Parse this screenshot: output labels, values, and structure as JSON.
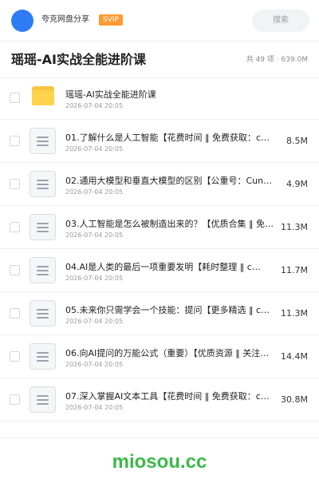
{
  "header": {
    "user_name": "夸克网盘分享",
    "badge": "SVIP",
    "search_placeholder": "搜索"
  },
  "folder": {
    "title": "瑶瑶-AI实战全能进阶课",
    "stats": "共 49 项 · 639.0M"
  },
  "files": [
    {
      "type": "folder",
      "name": "瑶瑶-AI实战全能进阶课",
      "date": "2026-07-04 20:05",
      "size": ""
    },
    {
      "type": "file",
      "name": "01.了解什么是人工智能【花费时间 ‖ 免费获取：cu…",
      "date": "2026-07-04 20:05",
      "size": "8.5M"
    },
    {
      "type": "file",
      "name": "02.通用大模型和垂直大模型的区别【公重号：Cun…",
      "date": "2026-07-04 20:05",
      "size": "4.9M"
    },
    {
      "type": "file",
      "name": "03.人工智能是怎么被制造出来的？【优质合集 ‖ 免费…",
      "date": "2026-07-04 20:05",
      "size": "11.3M"
    },
    {
      "type": "file",
      "name": "04.AI是人类的最后一项重要发明【耗时整理 ‖ c…",
      "date": "2026-07-04 20:05",
      "size": "11.7M"
    },
    {
      "type": "file",
      "name": "05.未来你只需学会一个技能：提问【更多精选 ‖ c…",
      "date": "2026-07-04 20:05",
      "size": "11.3M"
    },
    {
      "type": "file",
      "name": "06.向AI提问的万能公式（重要）【优质资源 ‖ 关注…",
      "date": "2026-07-04 20:05",
      "size": "14.4M"
    },
    {
      "type": "file",
      "name": "07.深入掌握AI文本工具【花费时间 ‖ 免费获取：c…",
      "date": "2026-07-04 20:05",
      "size": "30.8M"
    }
  ],
  "footer": {
    "watermark": "miosou.cc"
  },
  "colors": {
    "avatar": "#2d7cf6",
    "badge": "#ff9a2e",
    "folder": "#ffd34d",
    "watermark": "#3bb84a"
  }
}
